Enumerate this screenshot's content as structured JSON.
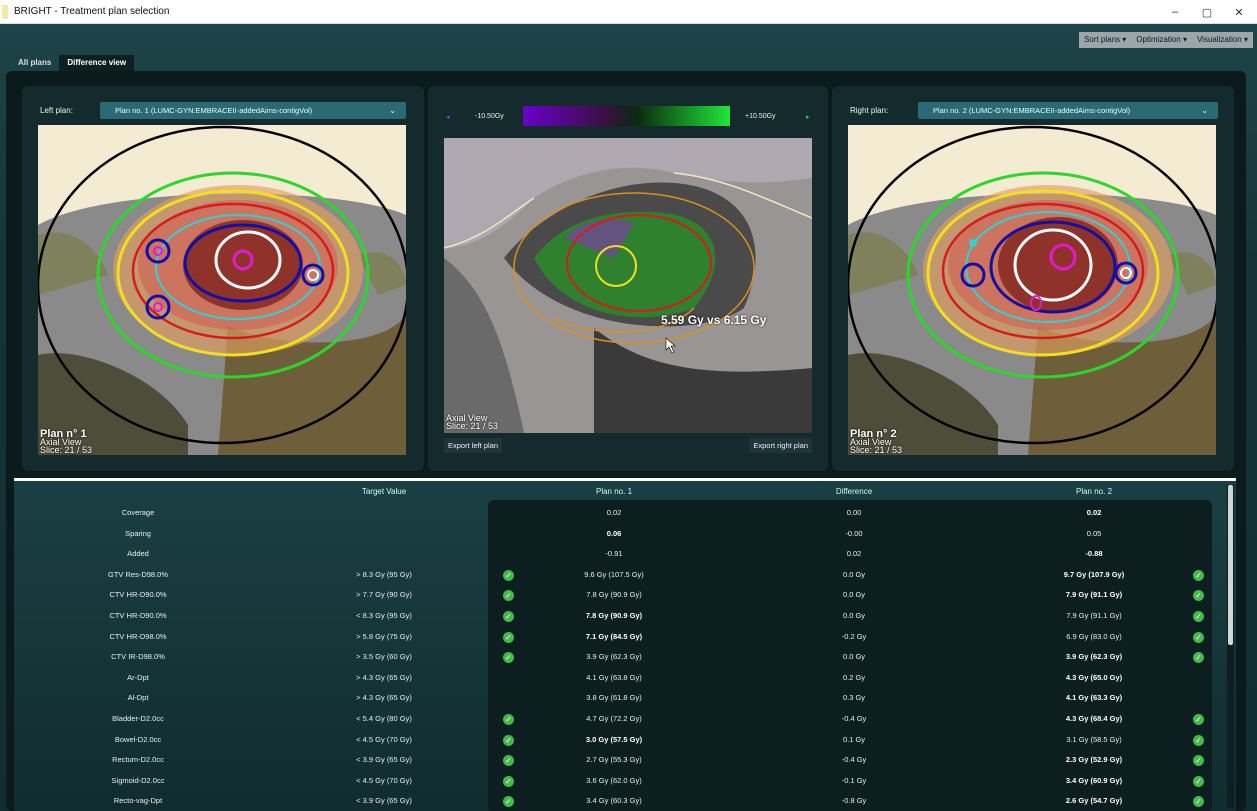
{
  "window": {
    "title": "BRIGHT - Treatment plan selection",
    "minimize": "–",
    "maximize": "▢",
    "close": "✕"
  },
  "toolbar": {
    "sort": "Sort plans ▾",
    "optimization": "Optimization ▾",
    "visualization": "Visualization ▾"
  },
  "tabs": {
    "all": "All plans",
    "diff": "Difference view"
  },
  "left_panel": {
    "label": "Left plan:",
    "selected": "Plan no. 1 (LUMC-GYN:EMBRACEII-addedAims-contigVol)",
    "overlay_title": "Plan n° 1",
    "overlay_view": "Axial View",
    "overlay_slice": "Slice: 21 / 53"
  },
  "right_panel": {
    "label": "Right plan:",
    "selected": "Plan no. 2 (LUMC-GYN:EMBRACEII-addedAims-contigVol)",
    "overlay_title": "Plan n° 2",
    "overlay_view": "Axial View",
    "overlay_slice": "Slice: 21 / 53"
  },
  "center_panel": {
    "min_label": "-10.50Gy",
    "max_label": "+10.50Gy",
    "overlay_view": "Axial View",
    "overlay_slice": "Slice: 21 / 53",
    "probe": "5.59 Gy   vs   6.15 Gy",
    "export_left": "Export left plan",
    "export_right": "Export right plan"
  },
  "colors": {
    "accent": "#2b6a72",
    "check": "#45b94a",
    "diff_min": "#6a00c8",
    "diff_max": "#1fe73a"
  },
  "table": {
    "headers": {
      "target": "Target Value",
      "plan1": "Plan no. 1",
      "diff": "Difference",
      "plan2": "Plan no. 2"
    },
    "rows": [
      {
        "name": "Coverage",
        "target": "",
        "p1": "0.02",
        "diff": "0.00",
        "p2": "0.02",
        "b1": false,
        "b2": true,
        "c1": false,
        "c2": false
      },
      {
        "name": "Sparing",
        "target": "",
        "p1": "0.06",
        "diff": "-0.00",
        "p2": "0.05",
        "b1": true,
        "b2": false,
        "c1": false,
        "c2": false
      },
      {
        "name": "Added",
        "target": "",
        "p1": "-0.91",
        "diff": "0.02",
        "p2": "-0.88",
        "b1": false,
        "b2": true,
        "c1": false,
        "c2": false
      },
      {
        "name": "GTV Res-D98.0%",
        "target": "> 8.3 Gy (95 Gy)",
        "p1": "9.6 Gy (107.5 Gy)",
        "diff": "0.0 Gy",
        "p2": "9.7 Gy (107.9 Gy)",
        "b1": false,
        "b2": true,
        "c1": true,
        "c2": true
      },
      {
        "name": "CTV HR-D90.0%",
        "target": "> 7.7 Gy (90 Gy)",
        "p1": "7.8 Gy (90.9 Gy)",
        "diff": "0.0 Gy",
        "p2": "7.9 Gy (91.1 Gy)",
        "b1": false,
        "b2": true,
        "c1": true,
        "c2": true
      },
      {
        "name": "CTV HR-D90.0%",
        "target": "< 8.3 Gy (95 Gy)",
        "p1": "7.8 Gy (90.9 Gy)",
        "diff": "0.0 Gy",
        "p2": "7.9 Gy (91.1 Gy)",
        "b1": true,
        "b2": false,
        "c1": true,
        "c2": true
      },
      {
        "name": "CTV HR-D98.0%",
        "target": "> 5.8 Gy (75 Gy)",
        "p1": "7.1 Gy (84.5 Gy)",
        "diff": "-0.2 Gy",
        "p2": "6.9 Gy (83.0 Gy)",
        "b1": true,
        "b2": false,
        "c1": true,
        "c2": true
      },
      {
        "name": "CTV IR-D98.0%",
        "target": "> 3.5 Gy (60 Gy)",
        "p1": "3.9 Gy (62.3 Gy)",
        "diff": "0.0 Gy",
        "p2": "3.9 Gy (62.3 Gy)",
        "b1": false,
        "b2": true,
        "c1": true,
        "c2": true
      },
      {
        "name": "Ar-Dpt",
        "target": "> 4.3 Gy (65 Gy)",
        "p1": "4.1 Gy (63.8 Gy)",
        "diff": "0.2 Gy",
        "p2": "4.3 Gy (65.0 Gy)",
        "b1": false,
        "b2": true,
        "c1": false,
        "c2": false
      },
      {
        "name": "Al-Dpt",
        "target": "> 4.3 Gy (65 Gy)",
        "p1": "3.8 Gy (61.8 Gy)",
        "diff": "0.3 Gy",
        "p2": "4.1 Gy (63.3 Gy)",
        "b1": false,
        "b2": true,
        "c1": false,
        "c2": false
      },
      {
        "name": "Bladder-D2.0cc",
        "target": "< 5.4 Gy (80 Gy)",
        "p1": "4.7 Gy (72.2 Gy)",
        "diff": "-0.4 Gy",
        "p2": "4.3 Gy (68.4 Gy)",
        "b1": false,
        "b2": true,
        "c1": true,
        "c2": true
      },
      {
        "name": "Bowel-D2.0cc",
        "target": "< 4.5 Gy (70 Gy)",
        "p1": "3.0 Gy (57.5 Gy)",
        "diff": "0.1 Gy",
        "p2": "3.1 Gy (58.5 Gy)",
        "b1": true,
        "b2": false,
        "c1": true,
        "c2": true
      },
      {
        "name": "Rectum-D2.0cc",
        "target": "< 3.9 Gy (65 Gy)",
        "p1": "2.7 Gy (55.3 Gy)",
        "diff": "-0.4 Gy",
        "p2": "2.3 Gy (52.9 Gy)",
        "b1": false,
        "b2": true,
        "c1": true,
        "c2": true
      },
      {
        "name": "Sigmoid-D2.0cc",
        "target": "< 4.5 Gy (70 Gy)",
        "p1": "3.6 Gy (62.0 Gy)",
        "diff": "-0.1 Gy",
        "p2": "3.4 Gy (60.9 Gy)",
        "b1": false,
        "b2": true,
        "c1": true,
        "c2": true
      },
      {
        "name": "Recto-vag-Dpt",
        "target": "< 3.9 Gy (65 Gy)",
        "p1": "3.4 Gy (60.3 Gy)",
        "diff": "-0.8 Gy",
        "p2": "2.6 Gy (54.7 Gy)",
        "b1": false,
        "b2": true,
        "c1": true,
        "c2": true
      }
    ]
  }
}
